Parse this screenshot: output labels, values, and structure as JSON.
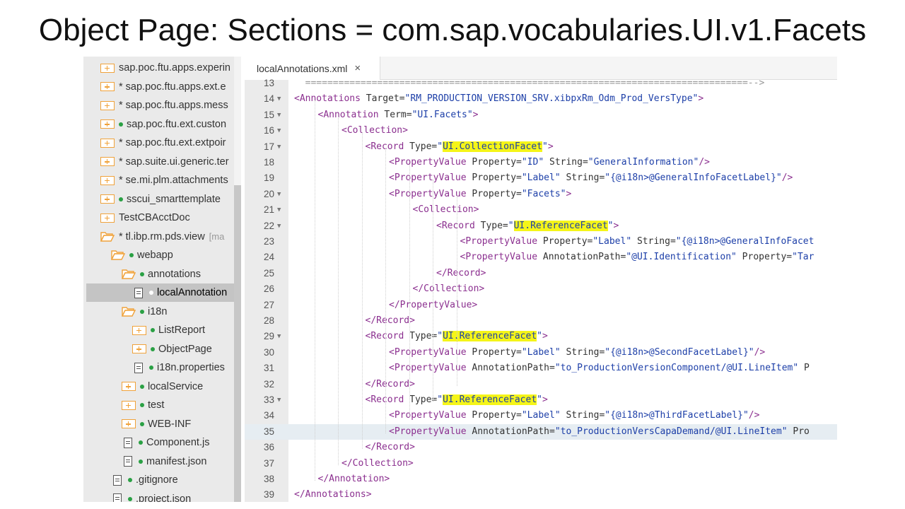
{
  "slide": {
    "title": "Object Page: Sections = com.sap.vocabularies.UI.v1.Facets"
  },
  "tree": {
    "items": [
      {
        "label": "sap.poc.ftu.apps.experin",
        "star": "",
        "dot": "",
        "icon": "folder",
        "indent": 0
      },
      {
        "label": "sap.poc.ftu.apps.ext.e",
        "star": "*",
        "dot": "",
        "icon": "folder",
        "indent": 0
      },
      {
        "label": "sap.poc.ftu.apps.mess",
        "star": "*",
        "dot": "",
        "icon": "folder",
        "indent": 0
      },
      {
        "label": "sap.poc.ftu.ext.custon",
        "star": "",
        "dot": "green",
        "icon": "folder",
        "indent": 0
      },
      {
        "label": "sap.poc.ftu.ext.extpoir",
        "star": "*",
        "dot": "",
        "icon": "folder",
        "indent": 0
      },
      {
        "label": "sap.suite.ui.generic.ter",
        "star": "*",
        "dot": "",
        "icon": "folder",
        "indent": 0
      },
      {
        "label": "se.mi.plm.attachments",
        "star": "*",
        "dot": "",
        "icon": "folder",
        "indent": 0
      },
      {
        "label": "sscui_smarttemplate",
        "star": "",
        "dot": "green",
        "icon": "folder",
        "indent": 0
      },
      {
        "label": "TestCBAcctDoc",
        "star": "",
        "dot": "",
        "icon": "folder",
        "indent": 0
      },
      {
        "label": "tl.ibp.rm.pds.view",
        "star": "*",
        "dot": "",
        "icon": "folder-open",
        "indent": 0,
        "suffix": "[ma"
      },
      {
        "label": "webapp",
        "star": "",
        "dot": "green",
        "icon": "folder-open",
        "indent": 1
      },
      {
        "label": "annotations",
        "star": "",
        "dot": "green",
        "icon": "folder-open",
        "indent": 2
      },
      {
        "label": "localAnnotation",
        "star": "",
        "dot": "white",
        "icon": "file",
        "indent": 3,
        "selected": true
      },
      {
        "label": "i18n",
        "star": "",
        "dot": "green",
        "icon": "folder-open",
        "indent": 2
      },
      {
        "label": "ListReport",
        "star": "",
        "dot": "green",
        "icon": "folder",
        "indent": 3
      },
      {
        "label": "ObjectPage",
        "star": "",
        "dot": "green",
        "icon": "folder",
        "indent": 3
      },
      {
        "label": "i18n.properties",
        "star": "",
        "dot": "green",
        "icon": "file",
        "indent": 3
      },
      {
        "label": "localService",
        "star": "",
        "dot": "green",
        "icon": "folder",
        "indent": 2
      },
      {
        "label": "test",
        "star": "",
        "dot": "green",
        "icon": "folder",
        "indent": 2
      },
      {
        "label": "WEB-INF",
        "star": "",
        "dot": "green",
        "icon": "folder",
        "indent": 2
      },
      {
        "label": "Component.js",
        "star": "",
        "dot": "green",
        "icon": "file",
        "indent": 2
      },
      {
        "label": "manifest.json",
        "star": "",
        "dot": "green",
        "icon": "file",
        "indent": 2
      },
      {
        "label": ".gitignore",
        "star": "",
        "dot": "green",
        "icon": "file",
        "indent": 1
      },
      {
        "label": ".project.json",
        "star": "",
        "dot": "green",
        "icon": "file",
        "indent": 1
      }
    ]
  },
  "editor": {
    "tab_label": "localAnnotations.xml",
    "tab_close": "×",
    "current_line": 35,
    "lines": [
      {
        "num": "13",
        "fold": false,
        "indent": 0,
        "tokens": [
          [
            "c",
            "  ================================================================================-->"
          ]
        ]
      },
      {
        "num": "14",
        "fold": true,
        "indent": 0,
        "tokens": [
          [
            "t",
            "<Annotations "
          ],
          [
            "a",
            "Target="
          ],
          [
            "s",
            "\"RM_PRODUCTION_VERSION_SRV.xibpxRm_Odm_Prod_VersType\""
          ],
          [
            "t",
            ">"
          ]
        ]
      },
      {
        "num": "15",
        "fold": true,
        "indent": 1,
        "tokens": [
          [
            "t",
            "<Annotation "
          ],
          [
            "a",
            "Term="
          ],
          [
            "s",
            "\"UI.Facets\""
          ],
          [
            "t",
            ">"
          ]
        ]
      },
      {
        "num": "16",
        "fold": true,
        "indent": 2,
        "tokens": [
          [
            "t",
            "<Collection>"
          ]
        ]
      },
      {
        "num": "17",
        "fold": true,
        "indent": 3,
        "tokens": [
          [
            "t",
            "<Record "
          ],
          [
            "a",
            "Type="
          ],
          [
            "s",
            "\""
          ],
          [
            "hl",
            "UI.CollectionFacet"
          ],
          [
            "s",
            "\""
          ],
          [
            "t",
            ">"
          ]
        ]
      },
      {
        "num": "18",
        "fold": false,
        "indent": 4,
        "tokens": [
          [
            "t",
            "<PropertyValue "
          ],
          [
            "a",
            "Property="
          ],
          [
            "s",
            "\"ID\""
          ],
          [
            "a",
            " String="
          ],
          [
            "s",
            "\"GeneralInformation\""
          ],
          [
            "t",
            "/>"
          ]
        ]
      },
      {
        "num": "19",
        "fold": false,
        "indent": 4,
        "tokens": [
          [
            "t",
            "<PropertyValue "
          ],
          [
            "a",
            "Property="
          ],
          [
            "s",
            "\"Label\""
          ],
          [
            "a",
            " String="
          ],
          [
            "s",
            "\"{@i18n>@GeneralInfoFacetLabel}\""
          ],
          [
            "t",
            "/>"
          ]
        ]
      },
      {
        "num": "20",
        "fold": true,
        "indent": 4,
        "tokens": [
          [
            "t",
            "<PropertyValue "
          ],
          [
            "a",
            "Property="
          ],
          [
            "s",
            "\"Facets\""
          ],
          [
            "t",
            ">"
          ]
        ]
      },
      {
        "num": "21",
        "fold": true,
        "indent": 5,
        "tokens": [
          [
            "t",
            "<Collection>"
          ]
        ]
      },
      {
        "num": "22",
        "fold": true,
        "indent": 6,
        "tokens": [
          [
            "t",
            "<Record "
          ],
          [
            "a",
            "Type="
          ],
          [
            "s",
            "\""
          ],
          [
            "hl",
            "UI.ReferenceFacet"
          ],
          [
            "s",
            "\""
          ],
          [
            "t",
            ">"
          ]
        ]
      },
      {
        "num": "23",
        "fold": false,
        "indent": 7,
        "tokens": [
          [
            "t",
            "<PropertyValue "
          ],
          [
            "a",
            "Property="
          ],
          [
            "s",
            "\"Label\""
          ],
          [
            "a",
            " String="
          ],
          [
            "s",
            "\"{@i18n>@GeneralInfoFacet"
          ]
        ]
      },
      {
        "num": "24",
        "fold": false,
        "indent": 7,
        "tokens": [
          [
            "t",
            "<PropertyValue "
          ],
          [
            "a",
            "AnnotationPath="
          ],
          [
            "s",
            "\"@UI.Identification\""
          ],
          [
            "a",
            " Property="
          ],
          [
            "s",
            "\"Tar"
          ]
        ]
      },
      {
        "num": "25",
        "fold": false,
        "indent": 6,
        "tokens": [
          [
            "t",
            "</Record>"
          ]
        ]
      },
      {
        "num": "26",
        "fold": false,
        "indent": 5,
        "tokens": [
          [
            "t",
            "</Collection>"
          ]
        ]
      },
      {
        "num": "27",
        "fold": false,
        "indent": 4,
        "tokens": [
          [
            "t",
            "</PropertyValue>"
          ]
        ]
      },
      {
        "num": "28",
        "fold": false,
        "indent": 3,
        "tokens": [
          [
            "t",
            "</Record>"
          ]
        ]
      },
      {
        "num": "29",
        "fold": true,
        "indent": 3,
        "tokens": [
          [
            "t",
            "<Record "
          ],
          [
            "a",
            "Type="
          ],
          [
            "s",
            "\""
          ],
          [
            "hl",
            "UI.ReferenceFacet"
          ],
          [
            "s",
            "\""
          ],
          [
            "t",
            ">"
          ]
        ]
      },
      {
        "num": "30",
        "fold": false,
        "indent": 4,
        "tokens": [
          [
            "t",
            "<PropertyValue "
          ],
          [
            "a",
            "Property="
          ],
          [
            "s",
            "\"Label\""
          ],
          [
            "a",
            " String="
          ],
          [
            "s",
            "\"{@i18n>@SecondFacetLabel}\""
          ],
          [
            "t",
            "/>"
          ]
        ]
      },
      {
        "num": "31",
        "fold": false,
        "indent": 4,
        "tokens": [
          [
            "t",
            "<PropertyValue "
          ],
          [
            "a",
            "AnnotationPath="
          ],
          [
            "s",
            "\"to_ProductionVersionComponent/@UI.LineItem\""
          ],
          [
            "a",
            " P"
          ]
        ]
      },
      {
        "num": "32",
        "fold": false,
        "indent": 3,
        "tokens": [
          [
            "t",
            "</Record>"
          ]
        ]
      },
      {
        "num": "33",
        "fold": true,
        "indent": 3,
        "tokens": [
          [
            "t",
            "<Record "
          ],
          [
            "a",
            "Type="
          ],
          [
            "s",
            "\""
          ],
          [
            "hl",
            "UI.ReferenceFacet"
          ],
          [
            "s",
            "\""
          ],
          [
            "t",
            ">"
          ]
        ]
      },
      {
        "num": "34",
        "fold": false,
        "indent": 4,
        "tokens": [
          [
            "t",
            "<PropertyValue "
          ],
          [
            "a",
            "Property="
          ],
          [
            "s",
            "\"Label\""
          ],
          [
            "a",
            " String="
          ],
          [
            "s",
            "\"{@i18n>@ThirdFacetLabel}\""
          ],
          [
            "t",
            "/>"
          ]
        ]
      },
      {
        "num": "35",
        "fold": false,
        "indent": 4,
        "tokens": [
          [
            "t",
            "<PropertyValue "
          ],
          [
            "a",
            "AnnotationPath="
          ],
          [
            "s",
            "\"to_ProductionVersCapaDemand/@UI.LineItem\""
          ],
          [
            "a",
            " Pro"
          ]
        ]
      },
      {
        "num": "36",
        "fold": false,
        "indent": 3,
        "tokens": [
          [
            "t",
            "</Record>"
          ]
        ]
      },
      {
        "num": "37",
        "fold": false,
        "indent": 2,
        "tokens": [
          [
            "t",
            "</Collection>"
          ]
        ]
      },
      {
        "num": "38",
        "fold": false,
        "indent": 1,
        "tokens": [
          [
            "t",
            "</Annotation>"
          ]
        ]
      },
      {
        "num": "39",
        "fold": false,
        "indent": 0,
        "tokens": [
          [
            "t",
            "</Annotations>"
          ]
        ]
      }
    ]
  },
  "colors": {
    "tag": "#8b2f8f",
    "string": "#1d3fa8",
    "highlight": "#f5f518",
    "folder": "#f0a23a",
    "git_dot": "#2aa044"
  },
  "icons": {
    "folder": "folder-icon",
    "folder_open": "folder-open-icon",
    "file": "file-icon",
    "fold": "fold-arrow-icon"
  }
}
